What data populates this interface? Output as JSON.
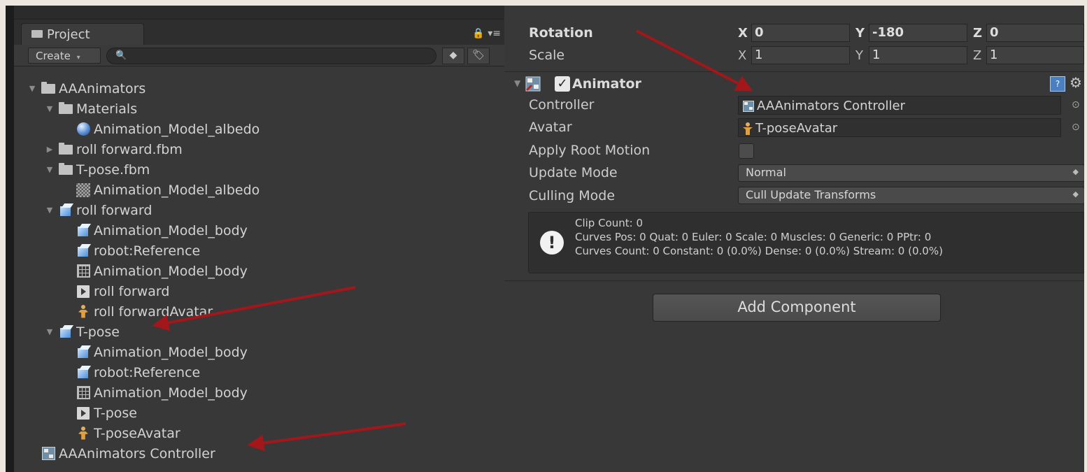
{
  "project_panel": {
    "tab_label": "Project",
    "create_label": "Create",
    "search_placeholder": "",
    "tree": [
      {
        "label": "AAAnimators",
        "icon": "folder-icon",
        "depth": 0,
        "expanded": true
      },
      {
        "label": "Materials",
        "icon": "folder-icon",
        "depth": 1,
        "expanded": true
      },
      {
        "label": "Animation_Model_albedo",
        "icon": "material-sphere-icon",
        "depth": 2
      },
      {
        "label": "roll forward.fbm",
        "icon": "folder-icon",
        "depth": 1,
        "expanded": false
      },
      {
        "label": "T-pose.fbm",
        "icon": "folder-icon",
        "depth": 1,
        "expanded": true
      },
      {
        "label": "Animation_Model_albedo",
        "icon": "texture-icon",
        "depth": 2
      },
      {
        "label": "roll forward",
        "icon": "model-cube-icon",
        "depth": 1,
        "expanded": true
      },
      {
        "label": "Animation_Model_body",
        "icon": "model-cube-icon",
        "depth": 2
      },
      {
        "label": "robot:Reference",
        "icon": "model-cube-icon",
        "depth": 2
      },
      {
        "label": "Animation_Model_body",
        "icon": "mesh-grid-icon",
        "depth": 2
      },
      {
        "label": "roll forward",
        "icon": "animation-clip-icon",
        "depth": 2
      },
      {
        "label": "roll forwardAvatar",
        "icon": "avatar-icon",
        "depth": 2
      },
      {
        "label": "T-pose",
        "icon": "model-cube-icon",
        "depth": 1,
        "expanded": true
      },
      {
        "label": "Animation_Model_body",
        "icon": "model-cube-icon",
        "depth": 2
      },
      {
        "label": "robot:Reference",
        "icon": "model-cube-icon",
        "depth": 2
      },
      {
        "label": "Animation_Model_body",
        "icon": "mesh-grid-icon",
        "depth": 2
      },
      {
        "label": "T-pose",
        "icon": "animation-clip-icon",
        "depth": 2
      },
      {
        "label": "T-poseAvatar",
        "icon": "avatar-icon",
        "depth": 2
      },
      {
        "label": "AAAnimators Controller",
        "icon": "animator-controller-icon",
        "depth": 0
      }
    ]
  },
  "inspector": {
    "transform": {
      "rotation_label": "Rotation",
      "scale_label": "Scale",
      "axis_x": "X",
      "axis_y": "Y",
      "axis_z": "Z",
      "rotation": {
        "x": "0",
        "y": "-180",
        "z": "0"
      },
      "scale": {
        "x": "1",
        "y": "1",
        "z": "1"
      }
    },
    "animator": {
      "title": "Animator",
      "enabled_mark": "✓",
      "controller_label": "Controller",
      "controller_value": "AAAnimators Controller",
      "avatar_label": "Avatar",
      "avatar_value": "T-poseAvatar",
      "apply_root_motion_label": "Apply Root Motion",
      "update_mode_label": "Update Mode",
      "update_mode_value": "Normal",
      "culling_mode_label": "Culling Mode",
      "culling_mode_value": "Cull Update Transforms",
      "info_lines": [
        "Clip Count: 0",
        "Curves Pos: 0 Quat: 0 Euler: 0 Scale: 0 Muscles: 0 Generic: 0 PPtr: 0",
        "Curves Count: 0 Constant: 0 (0.0%) Dense: 0 (0.0%) Stream: 0 (0.0%)"
      ],
      "info_icon_glyph": "!"
    },
    "add_component_label": "Add Component"
  },
  "colors": {
    "panel_bg": "#383838",
    "annotation_arrow": "#a3161a"
  }
}
